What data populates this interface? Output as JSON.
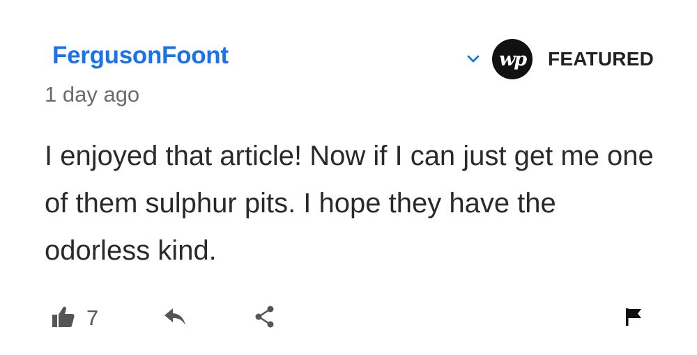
{
  "comment": {
    "username": "FergusonFoont",
    "timestamp": "1 day ago",
    "badge_logo": "wp",
    "badge_label": "FEATURED",
    "text": "I enjoyed that article! Now if I can just get me one of them sulphur pits. I hope they have the odorless kind.",
    "likes": "7"
  },
  "icons": {
    "expand": "chevron-down-icon",
    "like": "thumbs-up-icon",
    "reply": "reply-arrow-icon",
    "share": "share-icon",
    "flag": "flag-icon"
  },
  "colors": {
    "username": "#1a73e8",
    "logo_bg": "#111111",
    "text": "#2a2a2a",
    "meta": "#6b6b6b"
  }
}
